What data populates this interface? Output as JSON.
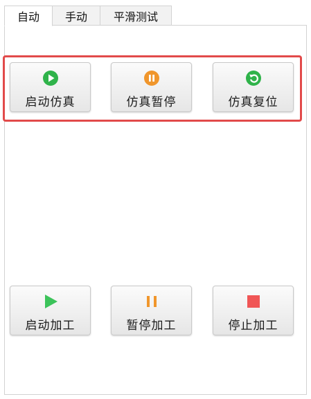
{
  "tabs": [
    {
      "label": "自动"
    },
    {
      "label": "手动"
    },
    {
      "label": "平滑测试"
    }
  ],
  "simulation": {
    "start_label": "启动仿真",
    "pause_label": "仿真暂停",
    "reset_label": "仿真复位"
  },
  "machining": {
    "start_label": "启动加工",
    "pause_label": "暂停加工",
    "stop_label": "停止加工"
  },
  "colors": {
    "highlight_border": "#e24a4a",
    "play_green": "#2fb34a",
    "pause_orange": "#f0962c",
    "stop_red": "#f05656"
  },
  "icons": {
    "start_sim": "play-circle-icon",
    "pause_sim": "pause-circle-icon",
    "reset_sim": "reset-circle-icon",
    "start_machining": "play-icon",
    "pause_machining": "pause-icon",
    "stop_machining": "stop-icon"
  }
}
